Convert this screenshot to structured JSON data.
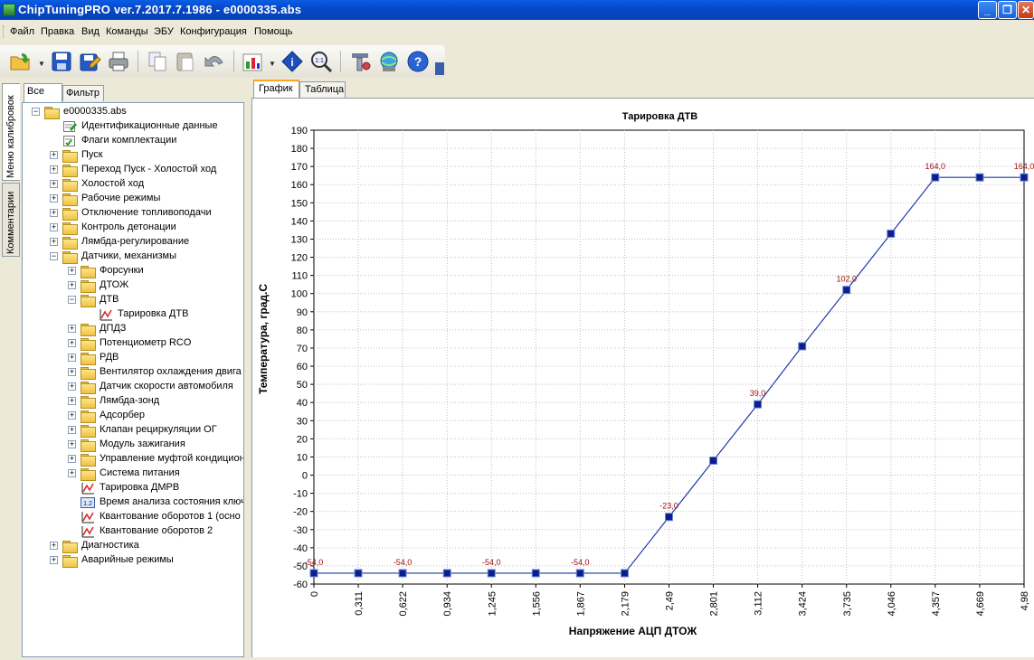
{
  "window": {
    "title": "ChipTuningPRO ver.7.2017.7.1986 - e0000335.abs",
    "buttons": {
      "minimize": "_",
      "maximize": "❐",
      "close": "✕"
    }
  },
  "menu": [
    "Файл",
    "Правка",
    "Вид",
    "Команды",
    "ЭБУ",
    "Конфигурация",
    "Помощь"
  ],
  "toolbar": {
    "icons": [
      "open-icon",
      "save-icon",
      "save-as-icon",
      "print-icon",
      "copy-icon",
      "paste-icon",
      "undo-icon",
      "chart-tool-icon",
      "info-icon",
      "zoom-icon",
      "settings-icon",
      "network-icon",
      "help-icon"
    ]
  },
  "side_tabs": [
    "Меню калибровок",
    "Комментарии"
  ],
  "left_tabs": [
    "Все",
    "Фильтр"
  ],
  "tree": [
    {
      "label": "e0000335.abs",
      "level": 0,
      "kind": "folder",
      "expander": "−"
    },
    {
      "label": "Идентификационные данные",
      "level": 1,
      "kind": "edit",
      "expander": ""
    },
    {
      "label": "Флаги комплектации",
      "level": 1,
      "kind": "flags",
      "expander": ""
    },
    {
      "label": "Пуск",
      "level": 1,
      "kind": "folder",
      "expander": "+"
    },
    {
      "label": "Переход Пуск - Холостой ход",
      "level": 1,
      "kind": "folder",
      "expander": "+"
    },
    {
      "label": "Холостой ход",
      "level": 1,
      "kind": "folder",
      "expander": "+"
    },
    {
      "label": "Рабочие режимы",
      "level": 1,
      "kind": "folder",
      "expander": "+"
    },
    {
      "label": "Отключение топливоподачи",
      "level": 1,
      "kind": "folder",
      "expander": "+"
    },
    {
      "label": "Контроль детонации",
      "level": 1,
      "kind": "folder",
      "expander": "+"
    },
    {
      "label": "Лямбда-регулирование",
      "level": 1,
      "kind": "folder",
      "expander": "+"
    },
    {
      "label": "Датчики, механизмы",
      "level": 1,
      "kind": "folder",
      "expander": "−"
    },
    {
      "label": "Форсунки",
      "level": 2,
      "kind": "folder",
      "expander": "+"
    },
    {
      "label": "ДТОЖ",
      "level": 2,
      "kind": "folder",
      "expander": "+"
    },
    {
      "label": "ДТВ",
      "level": 2,
      "kind": "folder",
      "expander": "−"
    },
    {
      "label": "Тарировка ДТВ",
      "level": 3,
      "kind": "graph",
      "expander": ""
    },
    {
      "label": "ДПДЗ",
      "level": 2,
      "kind": "folder",
      "expander": "+"
    },
    {
      "label": "Потенциометр RCO",
      "level": 2,
      "kind": "folder",
      "expander": "+"
    },
    {
      "label": "РДВ",
      "level": 2,
      "kind": "folder",
      "expander": "+"
    },
    {
      "label": "Вентилятор охлаждения двига",
      "level": 2,
      "kind": "folder",
      "expander": "+"
    },
    {
      "label": "Датчик скорости автомобиля",
      "level": 2,
      "kind": "folder",
      "expander": "+"
    },
    {
      "label": "Лямбда-зонд",
      "level": 2,
      "kind": "folder",
      "expander": "+"
    },
    {
      "label": "Адсорбер",
      "level": 2,
      "kind": "folder",
      "expander": "+"
    },
    {
      "label": "Клапан рециркуляции ОГ",
      "level": 2,
      "kind": "folder",
      "expander": "+"
    },
    {
      "label": "Модуль зажигания",
      "level": 2,
      "kind": "folder",
      "expander": "+"
    },
    {
      "label": "Управление муфтой кондицион",
      "level": 2,
      "kind": "folder",
      "expander": "+"
    },
    {
      "label": "Система питания",
      "level": 2,
      "kind": "folder",
      "expander": "+"
    },
    {
      "label": "Тарировка ДМРВ",
      "level": 2,
      "kind": "graph",
      "expander": ""
    },
    {
      "label": "Время анализа состояния ключ",
      "level": 2,
      "kind": "value",
      "expander": ""
    },
    {
      "label": "Квантование оборотов 1 (осно",
      "level": 2,
      "kind": "graph",
      "expander": ""
    },
    {
      "label": "Квантование оборотов 2",
      "level": 2,
      "kind": "graph",
      "expander": ""
    },
    {
      "label": "Диагностика",
      "level": 1,
      "kind": "folder",
      "expander": "+"
    },
    {
      "label": "Аварийные режимы",
      "level": 1,
      "kind": "folder",
      "expander": "+"
    }
  ],
  "right_tabs": [
    "График",
    "Таблица"
  ],
  "colors": {
    "series": "#1f3aa8",
    "marker": "#0b1f8c",
    "label": "#a01010",
    "grid": "#c0c0c0"
  },
  "chart_data": {
    "type": "line",
    "title": "Тарировка ДТВ",
    "xlabel": "Напряжение АЦП ДТОЖ",
    "ylabel": "Температура, град.С",
    "x_ticks": [
      "0",
      "0,311",
      "0,622",
      "0,934",
      "1,245",
      "1,556",
      "1,867",
      "2,179",
      "2,49",
      "2,801",
      "3,112",
      "3,424",
      "3,735",
      "4,046",
      "4,357",
      "4,669",
      "4,98"
    ],
    "x": [
      0,
      0.311,
      0.622,
      0.934,
      1.245,
      1.556,
      1.867,
      2.179,
      2.49,
      2.801,
      3.112,
      3.424,
      3.735,
      4.046,
      4.357,
      4.669,
      4.98
    ],
    "y": [
      -54,
      -54,
      -54,
      -54,
      -54,
      -54,
      -54,
      -54,
      -23,
      8,
      39,
      71,
      102,
      133,
      164,
      164,
      164
    ],
    "point_labels": [
      "-54,0",
      "",
      "-54,0",
      "",
      "-54,0",
      "",
      "-54,0",
      "",
      "-23,0",
      "",
      "39,0",
      "",
      "102,0",
      "",
      "164,0",
      "",
      "164,0"
    ],
    "xlim": [
      0,
      4.98
    ],
    "ylim": [
      -60,
      190
    ],
    "ytick_step": 10,
    "grid": true
  }
}
